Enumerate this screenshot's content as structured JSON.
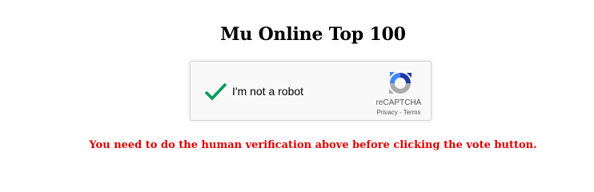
{
  "page": {
    "title": "Mu Online Top 100"
  },
  "recaptcha": {
    "checkbox_label": "I'm not a robot",
    "checked": true,
    "brand": "reCAPTCHA",
    "privacy_link": "Privacy",
    "separator": " - ",
    "terms_link": "Terms",
    "check_color": "#009e55",
    "logo_icon": "recaptcha-logo-icon"
  },
  "message": {
    "text": "You need to do the human verification above before clicking the vote button.",
    "color": "#e00000"
  }
}
